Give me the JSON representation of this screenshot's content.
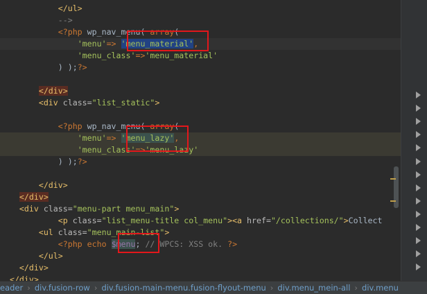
{
  "editor": {
    "lines": [
      [
        [
          "plain",
          "            "
        ],
        [
          "tag",
          "</ul>"
        ]
      ],
      [
        [
          "plain",
          "            "
        ],
        [
          "comment",
          "-->"
        ]
      ],
      [
        [
          "plain",
          "            "
        ],
        [
          "php",
          "<?php "
        ],
        [
          "fn",
          "wp_nav_menu"
        ],
        [
          "plain",
          "( "
        ],
        [
          "kw",
          "array"
        ],
        [
          "plain",
          "("
        ]
      ],
      [
        [
          "plain",
          "                "
        ],
        [
          "str",
          "'menu'"
        ],
        [
          "punc",
          "=>"
        ],
        [
          "plain",
          " "
        ],
        [
          "str",
          "'menu_material'"
        ],
        [
          "punc",
          ","
        ]
      ],
      [
        [
          "plain",
          "                "
        ],
        [
          "str",
          "'menu_class'"
        ],
        [
          "punc",
          "=>"
        ],
        [
          "str",
          "'menu_material'"
        ]
      ],
      [
        [
          "plain",
          "            "
        ],
        [
          "plain",
          ") );"
        ],
        [
          "php",
          "?>"
        ]
      ],
      [
        [
          "plain",
          ""
        ]
      ],
      [
        [
          "plain",
          "        "
        ],
        [
          "tag",
          "</div>"
        ]
      ],
      [
        [
          "plain",
          "        "
        ],
        [
          "tag",
          "<div "
        ],
        [
          "attr",
          "class="
        ],
        [
          "str",
          "\"list_static\""
        ],
        [
          "tag",
          ">"
        ]
      ],
      [
        [
          "plain",
          ""
        ]
      ],
      [
        [
          "plain",
          "            "
        ],
        [
          "php",
          "<?php "
        ],
        [
          "fn",
          "wp_nav_menu"
        ],
        [
          "plain",
          "( "
        ],
        [
          "kw",
          "array"
        ],
        [
          "plain",
          "("
        ]
      ],
      [
        [
          "plain",
          "                "
        ],
        [
          "str",
          "'menu'"
        ],
        [
          "punc",
          "=>"
        ],
        [
          "plain",
          " "
        ],
        [
          "str",
          "'menu_lazy'"
        ],
        [
          "punc",
          ","
        ]
      ],
      [
        [
          "plain",
          "                "
        ],
        [
          "str",
          "'menu_class'"
        ],
        [
          "punc",
          "=>"
        ],
        [
          "str",
          "'menu_lazy'"
        ]
      ],
      [
        [
          "plain",
          "            "
        ],
        [
          "plain",
          ") );"
        ],
        [
          "php",
          "?>"
        ]
      ],
      [
        [
          "plain",
          ""
        ]
      ],
      [
        [
          "plain",
          "        "
        ],
        [
          "tag",
          "</div>"
        ]
      ],
      [
        [
          "plain",
          "    "
        ],
        [
          "tag",
          "</div>"
        ]
      ],
      [
        [
          "plain",
          "    "
        ],
        [
          "tag",
          "<div "
        ],
        [
          "attr",
          "class="
        ],
        [
          "str",
          "\"menu-part menu_main\""
        ],
        [
          "tag",
          ">"
        ]
      ],
      [
        [
          "plain",
          "            "
        ],
        [
          "tag",
          "<p "
        ],
        [
          "attr",
          "class="
        ],
        [
          "str",
          "\"list_menu-title col_menu\""
        ],
        [
          "tag",
          ">"
        ],
        [
          "tag",
          "<a "
        ],
        [
          "attr",
          "href="
        ],
        [
          "str",
          "\"/collections/\""
        ],
        [
          "tag",
          ">"
        ],
        [
          "plain",
          "Collect"
        ]
      ],
      [
        [
          "plain",
          "        "
        ],
        [
          "tag",
          "<ul "
        ],
        [
          "attr",
          "class="
        ],
        [
          "str",
          "\"menu_main-list\""
        ],
        [
          "tag",
          ">"
        ]
      ],
      [
        [
          "plain",
          "            "
        ],
        [
          "php",
          "<?php "
        ],
        [
          "kw",
          "echo "
        ],
        [
          "var",
          "$menu"
        ],
        [
          "plain",
          "; "
        ],
        [
          "comment",
          "// WPCS: XSS ok. "
        ],
        [
          "php",
          "?>"
        ]
      ],
      [
        [
          "plain",
          "        "
        ],
        [
          "tag",
          "</ul>"
        ]
      ],
      [
        [
          "plain",
          "    "
        ],
        [
          "tag",
          "</div>"
        ]
      ],
      [
        [
          "plain",
          "  "
        ],
        [
          "tag",
          "</div>"
        ]
      ]
    ]
  },
  "breadcrumb": {
    "items": [
      "eader",
      "div.fusion-row",
      "div.fusion-main-menu.fusion-flyout-menu",
      "div.menu_mein-all",
      "div.menu"
    ]
  },
  "colors": {
    "background": "#2b2b2b",
    "tag": "#e8bf6a",
    "string": "#a5c25c",
    "keyword": "#cc7832",
    "highlight_box": "#e3171b"
  }
}
